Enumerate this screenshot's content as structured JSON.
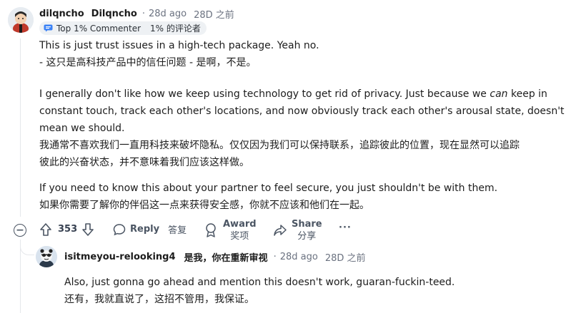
{
  "comment": {
    "username": "dilqncho",
    "username_display": "Dilqncho",
    "separator": "·",
    "time": "28d ago",
    "time_zh": "28D 之前",
    "flair": {
      "label": "Top 1% Commenter",
      "label_zh": "1% 的评论者",
      "icon": "commenter-flair-icon"
    },
    "paragraphs": [
      {
        "en": "This is just trust issues in a high-tech package. Yeah no.",
        "zh": "- 这只是高科技产品中的信任问题 - 是啊，不是。"
      },
      {
        "en_line1_pre": "I generally don't like how we keep using technology to get rid of privacy. Just because we ",
        "en_line1_em": "can",
        "en_line1_post": " keep in",
        "en_line2": "constant touch, track each other's locations, and now obviously track each other's arousal state, doesn't",
        "en_line3": "mean we should.",
        "zh_line1": "我通常不喜欢我们一直用科技来破坏隐私。仅仅因为我们可以保持联系，追踪彼此的位置，现在显然可以追踪",
        "zh_line2": "彼此的兴奋状态，并不意味着我们应该这样做。"
      },
      {
        "en": "If you need to know this about your partner to feel secure, you just shouldn't be with them.",
        "zh": "如果你需要了解你的伴侣这一点来获得安全感，你就不应该和他们在一起。"
      }
    ],
    "actions": {
      "collapse_symbol": "−",
      "score": "353",
      "reply": "Reply",
      "reply_zh": "答复",
      "award": "Award",
      "award_zh": "奖项",
      "share": "Share",
      "share_zh": "分享",
      "more": "···"
    }
  },
  "reply": {
    "username": "isitmeyou-relooking4",
    "username_zh": "是我，你在重新审视",
    "separator": "·",
    "time": "28d ago",
    "time_zh": "28D 之前",
    "en": "Also, just gonna go ahead and mention this doesn't work, guaran-fuckin-teed.",
    "zh": "还有，我就直说了，这招不管用，我保证。"
  },
  "colors": {
    "text": "#1c1c1c",
    "muted": "#6b7280",
    "flair_bg": "#eef1f4"
  }
}
